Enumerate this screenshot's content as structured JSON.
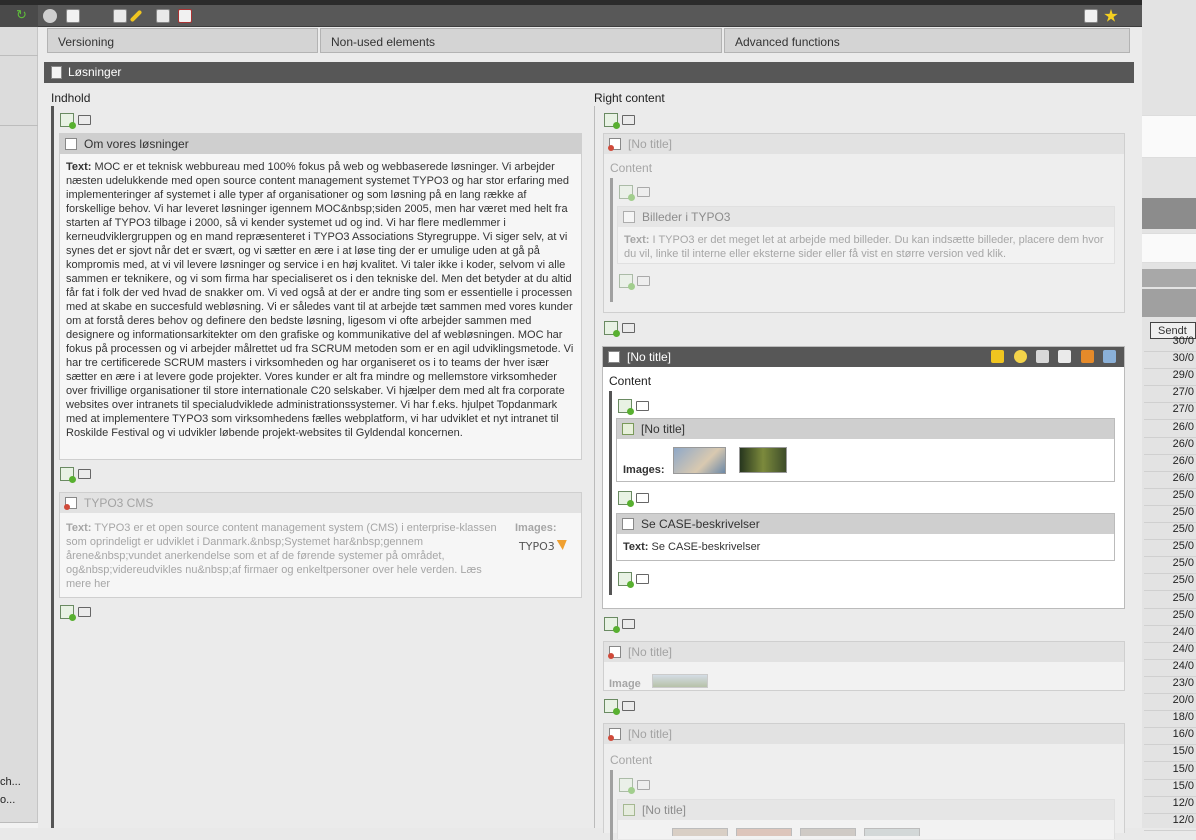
{
  "tabs": [
    "Versioning",
    "Non-used elements",
    "Advanced functions"
  ],
  "page": {
    "title": "Løsninger"
  },
  "left": {
    "heading": "Indhold",
    "ce1": {
      "title": "Om vores løsninger",
      "label": "Text:",
      "text": "MOC er et teknisk webbureau med 100% fokus på web og webbaserede løsninger. Vi arbejder næsten udelukkende med open source content management systemet TYPO3 og har stor erfaring med implementeringer af systemet i alle typer af organisationer og som løsning på en lang række af forskellige behov. Vi har leveret løsninger igennem MOC&nbsp;siden 2005, men har været med helt fra starten af TYPO3 tilbage i 2000, så vi kender systemet ud og ind. Vi har flere medlemmer i kerneudviklergruppen og en mand repræsenteret i TYPO3 Associations Styregruppe. Vi siger selv, at vi synes det er sjovt når det er svært, og vi sætter en ære i at løse ting der er umulige uden at gå på kompromis med, at vi vil levere løsninger og service i en høj kvalitet. Vi taler ikke i koder, selvom vi alle sammen er teknikere, og vi som firma har specialiseret os i den tekniske del. Men det betyder at du altid får fat i folk der ved hvad de snakker om. Vi ved også at der er andre ting som er essentielle i processen med at skabe en succesfuld webløsning. Vi er således vant til at arbejde tæt sammen med vores kunder om at forstå deres behov og definere den bedste løsning, ligesom vi ofte arbejder sammen med designere og informationsarkitekter om den grafiske og kommunikative del af webløsningen. MOC har fokus på processen og vi arbejder målrettet ud fra SCRUM metoden som er en agil udviklingsmetode. Vi har tre certificerede SCRUM masters i virksomheden og har organiseret os i to teams der hver især sætter en ære i at levere gode projekter. Vores kunder er alt fra mindre og mellemstore virksomheder over frivillige organisationer til store internationale C20 selskaber. Vi hjælper dem med alt fra corporate websites over intranets til specialudviklede administrationssystemer. Vi har f.eks. hjulpet Topdanmark med at implementere TYPO3 som virksomhedens fælles webplatform, vi har udviklet et nyt intranet til Roskilde Festival og vi udvikler løbende projekt-websites til Gyldendal koncernen."
    },
    "ce2": {
      "title": "TYPO3 CMS",
      "label": "Text:",
      "text": "TYPO3 er et open source content management system (CMS) i enterprise-klassen som oprindeligt er udviklet i Danmark.&nbsp;Systemet har&nbsp;gennem årene&nbsp;vundet anerkendelse som et af de førende systemer på området, og&nbsp;videreudvikles nu&nbsp;af firmaer og enkeltpersoner over hele verden. Læs mere her",
      "images_label": "Images:",
      "logo_text": "TYPO3"
    }
  },
  "right": {
    "heading": "Right content",
    "no_title": "[No title]",
    "content_label": "Content",
    "nested1": {
      "title": "Billeder i TYPO3",
      "label": "Text:",
      "text": "I TYPO3 er det meget let at arbejde med billeder. Du kan indsætte billeder, placere dem hvor du vil, linke til interne eller eksterne sider eller få vist en større version ved klik."
    },
    "images_label": "Images:",
    "case": {
      "title": "Se CASE-beskrivelser",
      "label": "Text:",
      "text": "Se CASE-beskrivelser"
    },
    "image_label": "Image"
  },
  "sidebar": {
    "item1": "ch...",
    "item2": "o..."
  },
  "list": {
    "header": "Sendt",
    "dates": [
      "30/0",
      "30/0",
      "29/0",
      "27/0",
      "27/0",
      "26/0",
      "26/0",
      "26/0",
      "26/0",
      "25/0",
      "25/0",
      "25/0",
      "25/0",
      "25/0",
      "25/0",
      "25/0",
      "25/0",
      "24/0",
      "24/0",
      "24/0",
      "23/0",
      "20/0",
      "18/0",
      "16/0",
      "15/0",
      "15/0",
      "15/0",
      "12/0",
      "12/0"
    ]
  },
  "colors": {
    "dark_bar": "#575757",
    "accent_green": "#58b030",
    "hidden_red": "#d04a3a"
  }
}
